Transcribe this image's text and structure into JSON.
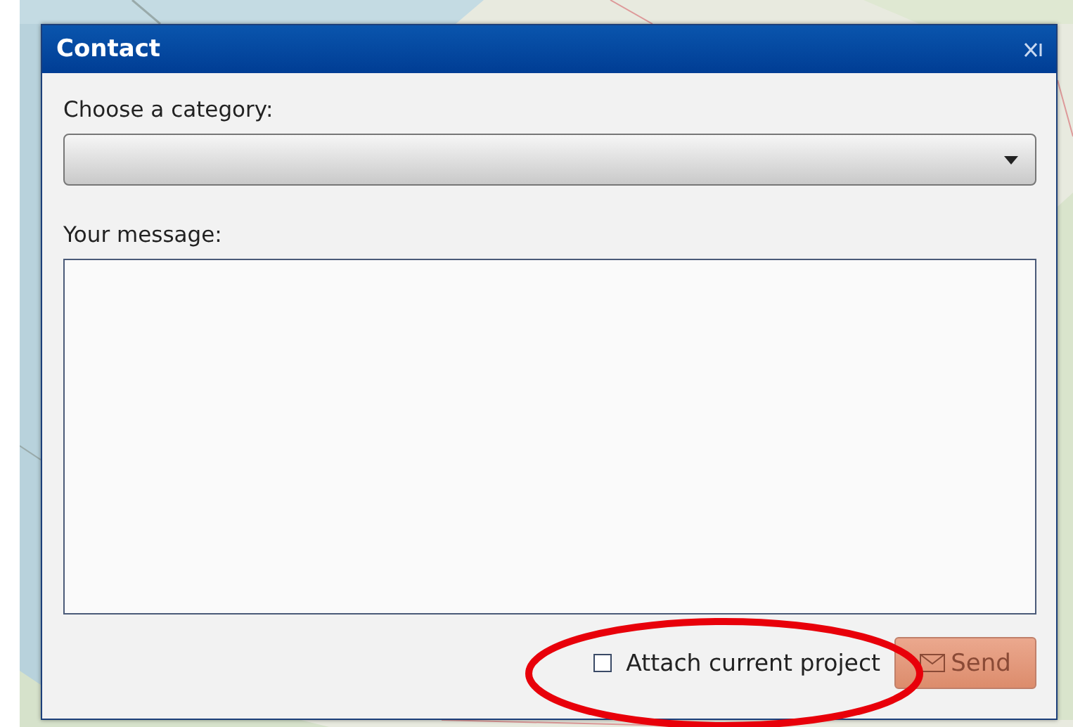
{
  "dialog": {
    "title": "Contact"
  },
  "category": {
    "label": "Choose a category:"
  },
  "message": {
    "label": "Your message:"
  },
  "attach": {
    "label": "Attach current project",
    "checked": false
  },
  "send": {
    "label": "Send",
    "disabled": true
  }
}
